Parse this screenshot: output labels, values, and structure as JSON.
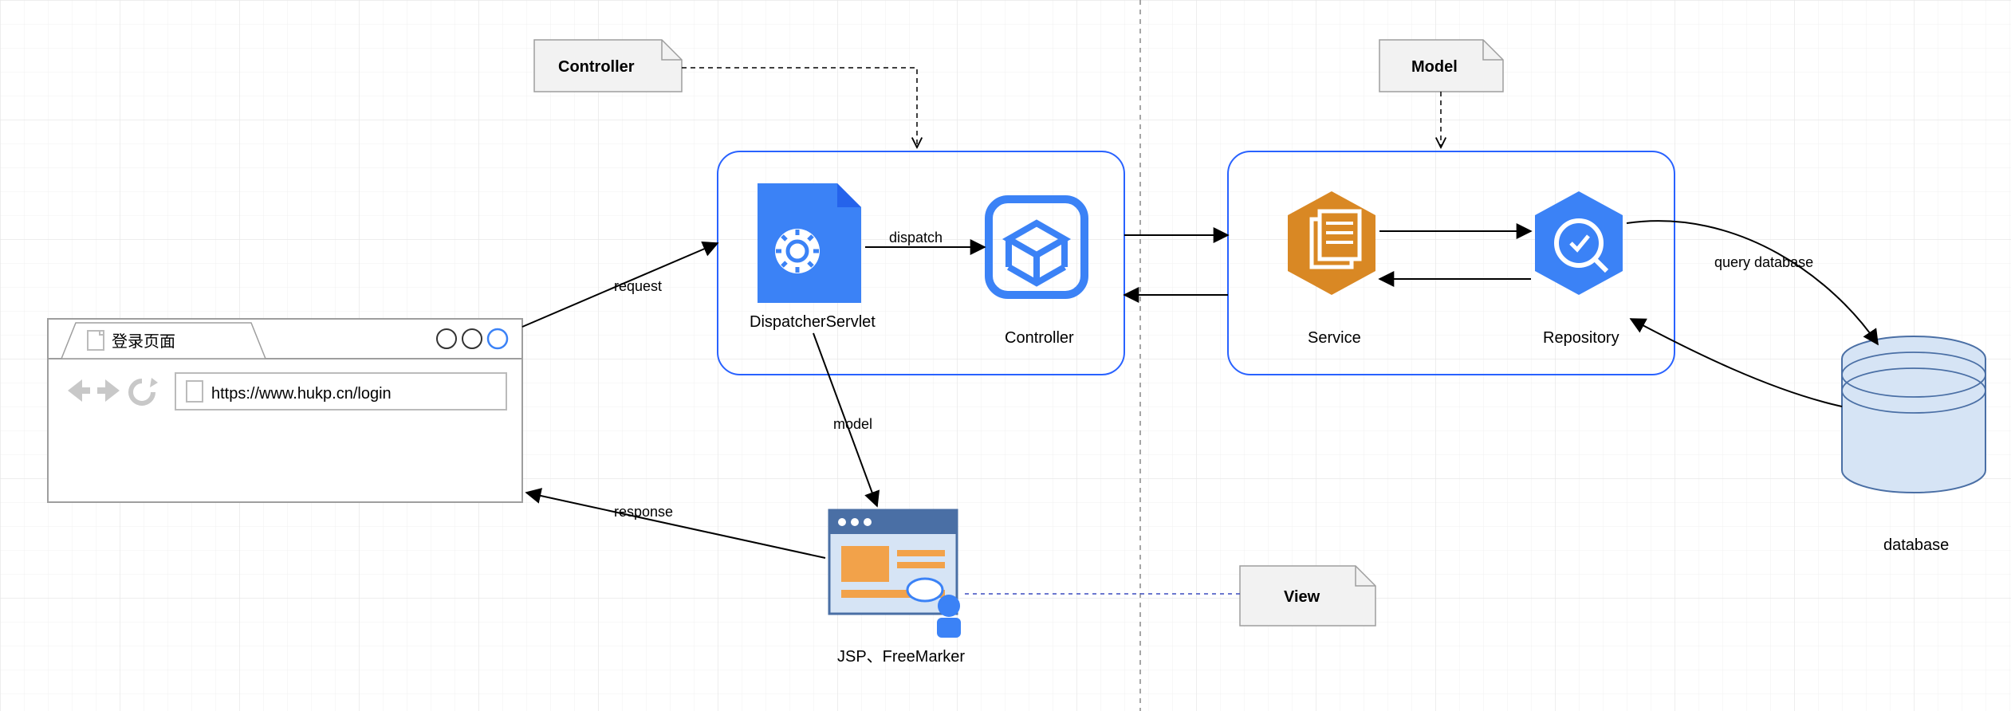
{
  "notes": {
    "controller": "Controller",
    "model": "Model",
    "view": "View"
  },
  "browser": {
    "tab_title": "登录页面",
    "url": "https://www.hukp.cn/login"
  },
  "nodes": {
    "dispatcher": "DispatcherServlet",
    "controller": "Controller",
    "service": "Service",
    "repository": "Repository",
    "view_engine": "JSP、FreeMarker",
    "database": "database"
  },
  "edges": {
    "request": "request",
    "dispatch": "dispatch",
    "model": "model",
    "response": "response",
    "query_db": "query database"
  },
  "colors": {
    "grid": "#f4f4f4",
    "region_border": "#2962ff",
    "note_bg": "#f2f2f2",
    "note_border": "#9e9e9e",
    "browser_border": "#9e9e9e",
    "blue_accent": "#3b82f6",
    "orange": "#d98824",
    "db_fill": "#d6e4f5",
    "db_stroke": "#4a6fa5"
  }
}
